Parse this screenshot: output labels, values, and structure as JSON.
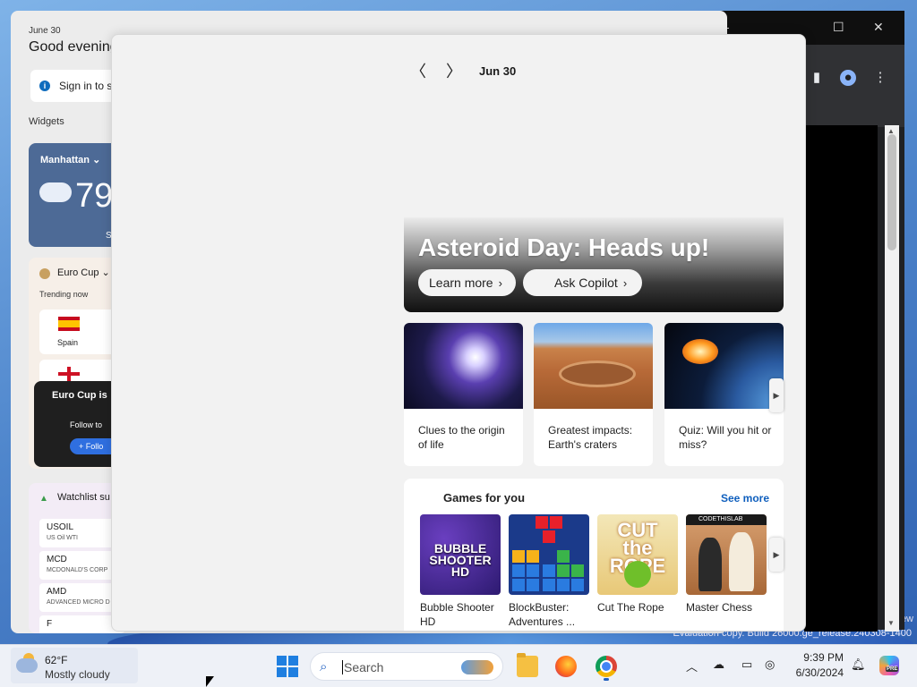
{
  "desktop": {
    "eval_line1": "ew",
    "eval_line2": "Evaluation copy. Build 26000.ge_release.240308-1400"
  },
  "browser": {
    "minimize": "—",
    "maximize": "☐",
    "close": "✕",
    "toolbar_icons": [
      "sidebar-icon",
      "profile-icon",
      "menu-icon"
    ]
  },
  "widgets": {
    "date": "June 30",
    "greeting": "Good evening",
    "signin": "Sign in to sa",
    "section": "Widgets",
    "weather": {
      "location": "Manhattan",
      "chevron": "⌄",
      "temp": "79",
      "more": "S"
    },
    "euro": {
      "title": "Euro Cup",
      "chevron": "⌄",
      "trending": "Trending now",
      "teams": [
        "Spain"
      ],
      "popup_title": "Euro Cup is",
      "popup_follow": "Follow to",
      "popup_button": "+ Follo"
    },
    "watchlist": {
      "title": "Watchlist su",
      "stocks": [
        {
          "symbol": "USOIL",
          "name": "US Oil WTI"
        },
        {
          "symbol": "MCD",
          "name": "MCDONALD'S CORP"
        },
        {
          "symbol": "AMD",
          "name": "ADVANCED MICRO D"
        },
        {
          "symbol": "F",
          "name": ""
        }
      ]
    }
  },
  "panel": {
    "prev": "〈",
    "next": "〉",
    "date": "Jun 30",
    "hero": {
      "title": "Asteroid Day: Heads up!",
      "learn_more": "Learn more",
      "ask_copilot": "Ask Copilot",
      "chevron": "›"
    },
    "tiles": [
      {
        "caption": "Clues to the origin of life"
      },
      {
        "caption": "Greatest impacts: Earth's craters"
      },
      {
        "caption": "Quiz: Will you hit or miss?"
      }
    ],
    "scroll_arrow": "▶",
    "games": {
      "title": "Games for you",
      "see_more": "See more",
      "items": [
        {
          "name": "Bubble Shooter HD",
          "art": "BUBBLE SHOOTER HD"
        },
        {
          "name": "BlockBuster: Adventures ...",
          "art": ""
        },
        {
          "name": "Cut The Rope",
          "art": "CUT the ROPE"
        },
        {
          "name": "Master Chess",
          "art": "CODETHISLAB"
        }
      ]
    }
  },
  "taskbar": {
    "weather_temp": "62°F",
    "weather_cond": "Mostly cloudy",
    "search_placeholder": "Search",
    "search_icon": "⌕",
    "tray_chevron": "︿",
    "clock_time": "9:39 PM",
    "clock_date": "6/30/2024",
    "copilot_badge": "PRE"
  },
  "colors": {
    "accent": "#0f5fbd",
    "panel_bg": "#f2f2f2",
    "weather_card": "#4d6a96",
    "follow_button": "#2f6fe0"
  }
}
